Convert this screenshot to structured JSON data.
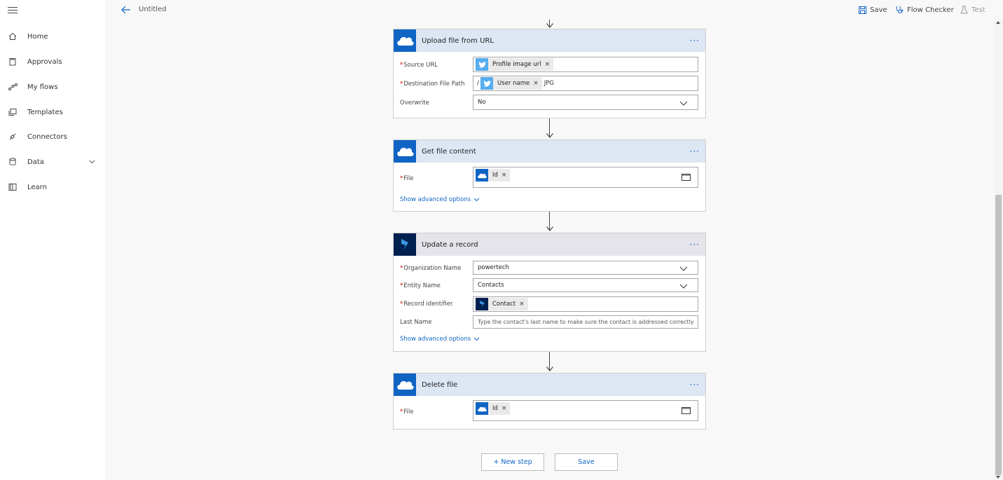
{
  "sidebar": {
    "menu_icon": "hamburger-icon",
    "items": [
      {
        "label": "Home",
        "icon": "home-icon"
      },
      {
        "label": "Approvals",
        "icon": "approvals-icon"
      },
      {
        "label": "My flows",
        "icon": "flows-icon"
      },
      {
        "label": "Templates",
        "icon": "templates-icon"
      },
      {
        "label": "Connectors",
        "icon": "connectors-icon"
      },
      {
        "label": "Data",
        "icon": "data-icon",
        "expandable": true
      },
      {
        "label": "Learn",
        "icon": "learn-icon"
      }
    ]
  },
  "header": {
    "title": "Untitled",
    "save_label": "Save",
    "flow_checker_label": "Flow Checker",
    "test_label": "Test"
  },
  "cards": {
    "upload": {
      "title": "Upload file from URL",
      "menu": "···",
      "source_url_label": "Source URL",
      "source_url_token": "Profile image url",
      "dest_path_label": "Destination File Path",
      "dest_path_prefix": "/",
      "dest_path_token": "User name",
      "dest_path_suffix": "JPG",
      "overwrite_label": "Overwrite",
      "overwrite_value": "No"
    },
    "getcontent": {
      "title": "Get file content",
      "menu": "···",
      "file_label": "File",
      "file_token": "Id",
      "advanced_label": "Show advanced options"
    },
    "update": {
      "title": "Update a record",
      "menu": "···",
      "org_label": "Organization Name",
      "org_value": "powertech",
      "entity_label": "Entity Name",
      "entity_value": "Contacts",
      "record_label": "Record identifier",
      "record_token": "Contact",
      "lastname_label": "Last Name",
      "lastname_placeholder": "Type the contact's last name to make sure the contact is addressed correctly",
      "advanced_label": "Show advanced options"
    },
    "delete": {
      "title": "Delete file",
      "menu": "···",
      "file_label": "File",
      "file_token": "Id"
    }
  },
  "footer": {
    "new_step_label": "+ New step",
    "save_label": "Save"
  },
  "colors": {
    "accent": "#0f64c4",
    "onedrive": "#0f64c4",
    "twitter": "#55acee",
    "dynamics": "#002050",
    "required": "#cc0000"
  }
}
